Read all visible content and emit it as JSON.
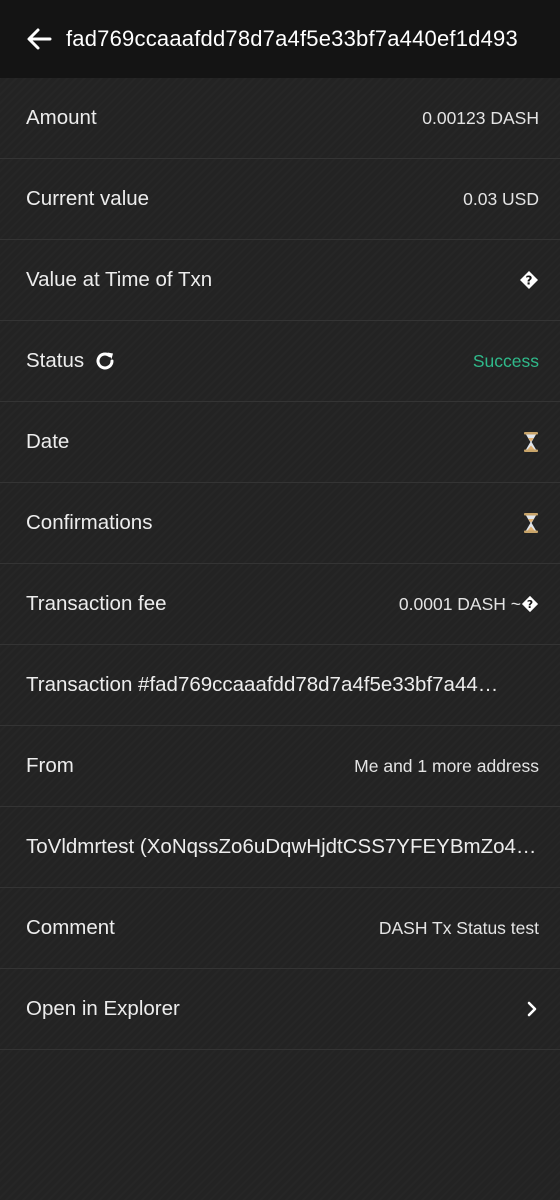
{
  "header": {
    "title": "fad769ccaaafdd78d7a4f5e33bf7a440ef1d493"
  },
  "rows": {
    "amount": {
      "label": "Amount",
      "value": "0.00123 DASH"
    },
    "current_value": {
      "label": "Current value",
      "value": "0.03 USD"
    },
    "value_at_time": {
      "label": "Value at Time of Txn"
    },
    "status": {
      "label": "Status",
      "value": "Success"
    },
    "date": {
      "label": "Date"
    },
    "confirmations": {
      "label": "Confirmations"
    },
    "fee": {
      "label": "Transaction fee",
      "value": "0.0001 DASH ~"
    },
    "transaction": {
      "text": "Transaction #fad769ccaaafdd78d7a4f5e33bf7a44…"
    },
    "from": {
      "label": "From",
      "value": "Me and 1 more address"
    },
    "to": {
      "text": "ToVldmrtest (XoNqssZo6uDqwHjdtCSS7YFEYBmZo4…"
    },
    "comment": {
      "label": "Comment",
      "value": "DASH Tx Status test"
    },
    "explorer": {
      "label": "Open in Explorer"
    }
  },
  "icons": {
    "back": "arrow-left-icon",
    "refresh": "refresh-icon",
    "unknown": "question-diamond-icon",
    "pending": "hourglass-icon",
    "chevron": "chevron-right-icon"
  },
  "colors": {
    "background": "#232323",
    "header": "#141414",
    "success": "#2fb98a",
    "divider": "#343434"
  }
}
